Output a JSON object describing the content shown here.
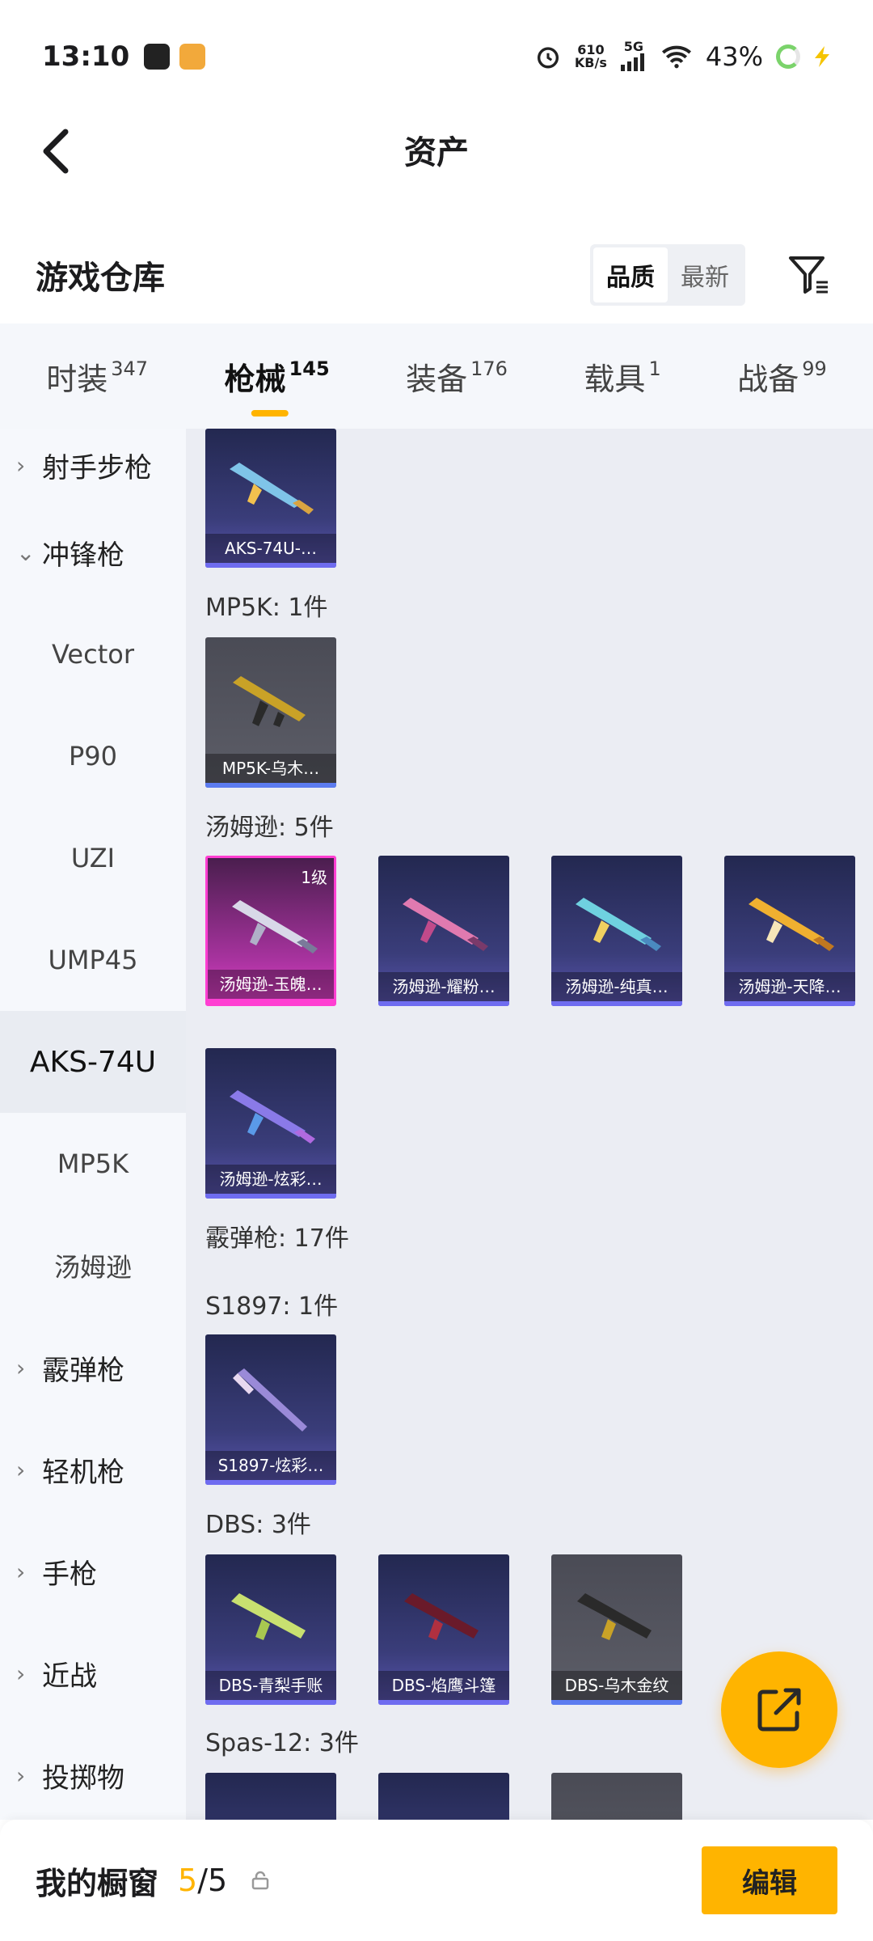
{
  "status_bar": {
    "time": "13:10",
    "net_speed": "610",
    "net_unit": "KB/s",
    "network": "5G",
    "battery": "43%"
  },
  "header": {
    "title": "资产"
  },
  "warehouse": {
    "title": "游戏仓库",
    "sort_options": [
      "品质",
      "最新"
    ],
    "sort_active": "品质"
  },
  "tabs": [
    {
      "label": "时装",
      "count": "347"
    },
    {
      "label": "枪械",
      "count": "145"
    },
    {
      "label": "装备",
      "count": "176"
    },
    {
      "label": "载具",
      "count": "1"
    },
    {
      "label": "战备",
      "count": "99"
    }
  ],
  "sidebar": {
    "items": [
      {
        "label": "射手步枪",
        "chevron": "›"
      },
      {
        "label": "冲锋枪",
        "chevron": "⌄"
      },
      {
        "label": "Vector"
      },
      {
        "label": "P90"
      },
      {
        "label": "UZI"
      },
      {
        "label": "UMP45"
      },
      {
        "label": "AKS-74U"
      },
      {
        "label": "MP5K"
      },
      {
        "label": "汤姆逊"
      },
      {
        "label": "霰弹枪",
        "chevron": "›"
      },
      {
        "label": "轻机枪",
        "chevron": "›"
      },
      {
        "label": "手枪",
        "chevron": "›"
      },
      {
        "label": "近战",
        "chevron": "›"
      },
      {
        "label": "投掷物",
        "chevron": "›"
      }
    ]
  },
  "content": {
    "sections": {
      "mp5k": "MP5K: 1件",
      "thompson": "汤姆逊: 5件",
      "shotgun": "霰弹枪: 17件",
      "s1897": "S1897: 1件",
      "dbs": "DBS: 3件",
      "spas": "Spas-12: 3件"
    },
    "cards": {
      "aks": {
        "label": "AKS-74U-…"
      },
      "mp5k": {
        "label": "MP5K-乌木…"
      },
      "thompson": [
        {
          "label": "汤姆逊-玉魄…",
          "level": "1级"
        },
        {
          "label": "汤姆逊-耀粉…"
        },
        {
          "label": "汤姆逊-纯真…"
        },
        {
          "label": "汤姆逊-天降…"
        },
        {
          "label": "汤姆逊-炫彩…"
        }
      ],
      "s1897": {
        "label": "S1897-炫彩…"
      },
      "dbs": [
        {
          "label": "DBS-青梨手账"
        },
        {
          "label": "DBS-焰鹰斗篷"
        },
        {
          "label": "DBS-乌木金纹"
        }
      ]
    }
  },
  "showcase": {
    "label": "我的橱窗",
    "current": "5",
    "total": "/5",
    "edit_label": "编辑"
  },
  "colors": {
    "accent": "#ffb400",
    "active_tab": "#111111"
  }
}
